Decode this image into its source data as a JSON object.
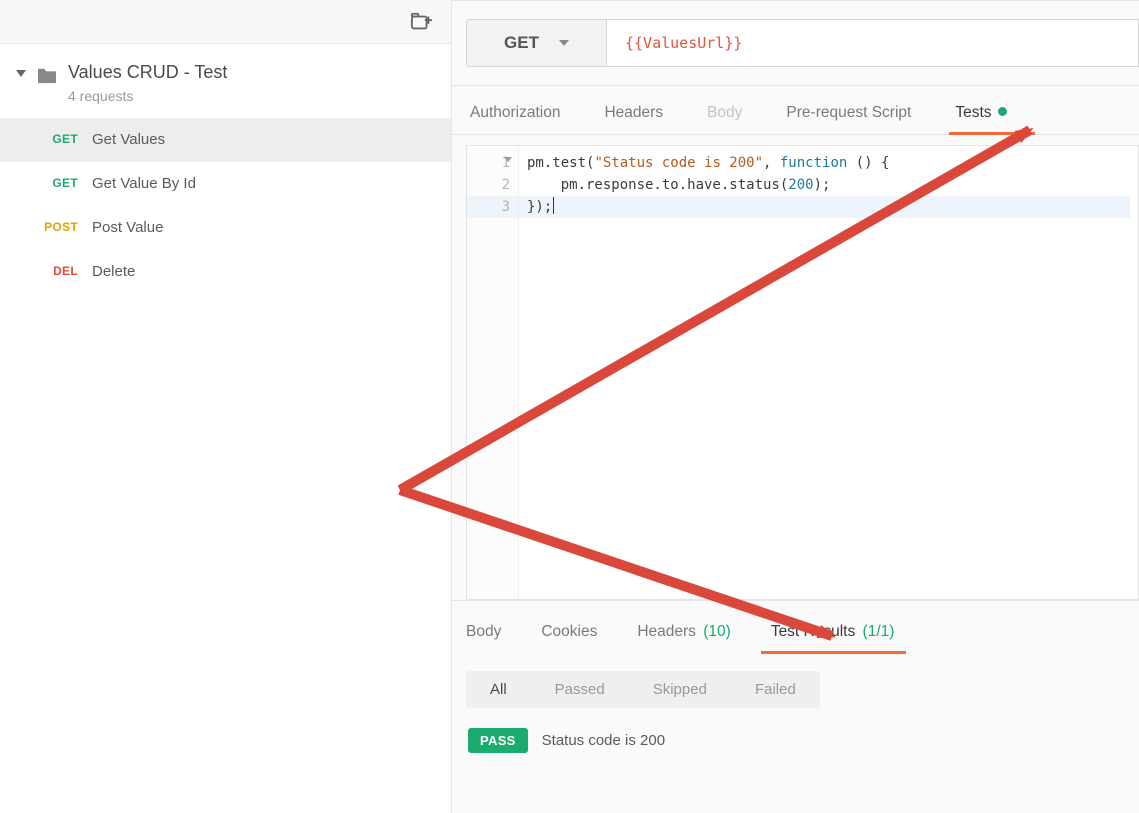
{
  "sidebar": {
    "collection_title": "Values CRUD - Test",
    "collection_sub": "4 requests",
    "items": [
      {
        "method": "GET",
        "method_cls": "get",
        "label": "Get Values",
        "active": true
      },
      {
        "method": "GET",
        "method_cls": "get",
        "label": "Get Value By Id",
        "active": false
      },
      {
        "method": "POST",
        "method_cls": "post",
        "label": "Post Value",
        "active": false
      },
      {
        "method": "DEL",
        "method_cls": "del",
        "label": "Delete",
        "active": false
      }
    ]
  },
  "request": {
    "method": "GET",
    "url": "{{ValuesUrl}}",
    "tabs": [
      {
        "label": "Authorization",
        "state": "normal"
      },
      {
        "label": "Headers",
        "state": "normal"
      },
      {
        "label": "Body",
        "state": "disabled"
      },
      {
        "label": "Pre-request Script",
        "state": "normal"
      },
      {
        "label": "Tests",
        "state": "active",
        "dot": true
      }
    ]
  },
  "editor": {
    "lines": [
      {
        "n": "1",
        "fold": true,
        "segments": [
          {
            "t": "pm.test("
          },
          {
            "t": "\"Status code is 200\"",
            "c": "tok-str"
          },
          {
            "t": ", "
          },
          {
            "t": "function",
            "c": "tok-kw"
          },
          {
            "t": " () {"
          }
        ]
      },
      {
        "n": "2",
        "segments": [
          {
            "t": "    pm.response.to.have.status("
          },
          {
            "t": "200",
            "c": "tok-num"
          },
          {
            "t": ");"
          }
        ]
      },
      {
        "n": "3",
        "cursor": true,
        "segments": [
          {
            "t": "});"
          }
        ]
      }
    ]
  },
  "response": {
    "tabs": [
      {
        "label": "Body"
      },
      {
        "label": "Cookies"
      },
      {
        "label": "Headers",
        "count": "(10)"
      },
      {
        "label": "Test Results",
        "count": "(1/1)",
        "active": true
      }
    ],
    "filters": [
      {
        "label": "All",
        "active": true
      },
      {
        "label": "Passed"
      },
      {
        "label": "Skipped"
      },
      {
        "label": "Failed"
      }
    ],
    "test_result": {
      "badge": "PASS",
      "name": "Status code is 200"
    }
  }
}
